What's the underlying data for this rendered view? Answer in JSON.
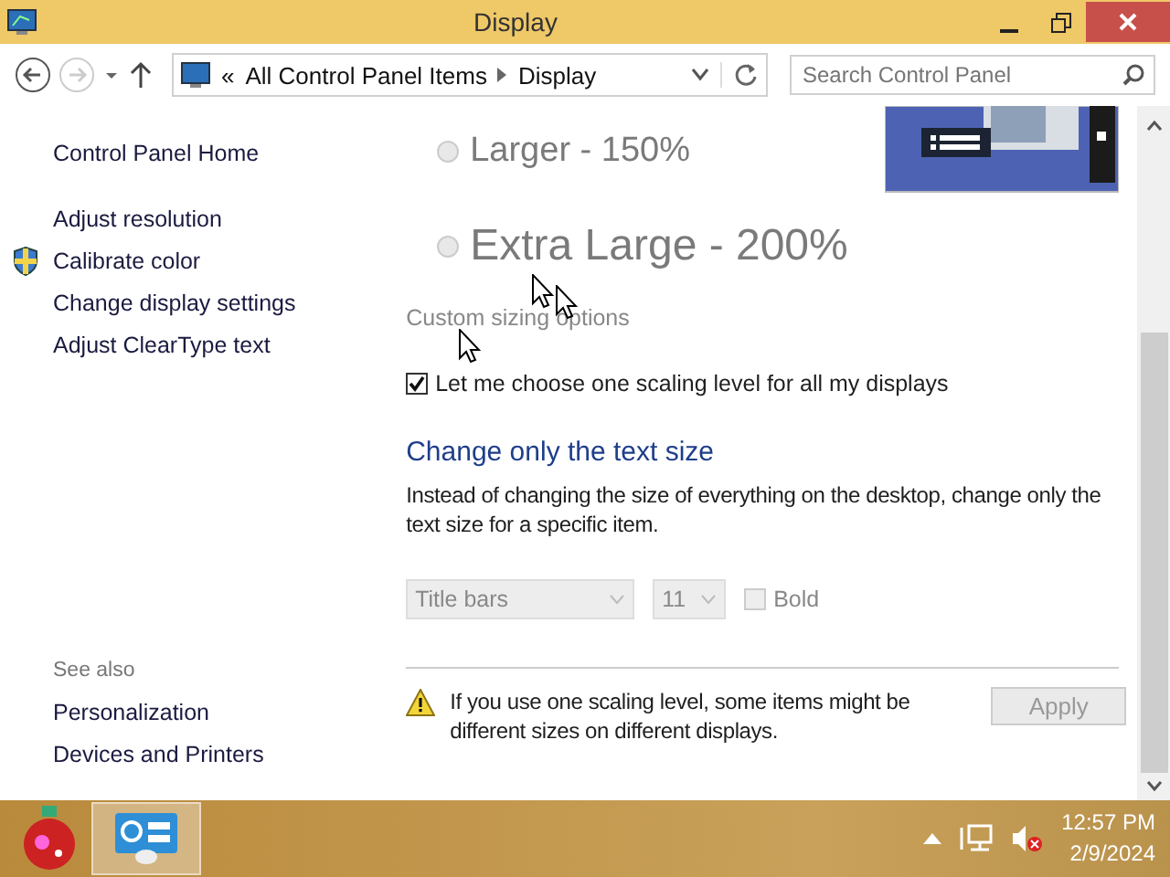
{
  "window": {
    "title": "Display"
  },
  "address_bar": {
    "prefix": "«",
    "crumbs": [
      "All Control Panel Items",
      "Display"
    ]
  },
  "search": {
    "placeholder": "Search Control Panel"
  },
  "sidebar": {
    "items": [
      {
        "label": "Control Panel Home",
        "shield": false
      },
      {
        "label": "Adjust resolution",
        "shield": false
      },
      {
        "label": "Calibrate color",
        "shield": true
      },
      {
        "label": "Change display settings",
        "shield": false
      },
      {
        "label": "Adjust ClearType text",
        "shield": false
      }
    ],
    "see_also": {
      "heading": "See also",
      "items": [
        "Personalization",
        "Devices and Printers"
      ]
    }
  },
  "scaling_options": [
    {
      "label": "Larger - 150%",
      "selected": false,
      "disabled": true,
      "kind": "large"
    },
    {
      "label": "Extra Large - 200%",
      "selected": false,
      "disabled": true,
      "kind": "xlarge"
    }
  ],
  "custom_sizing": {
    "label": "Custom sizing options",
    "disabled": true
  },
  "one_level": {
    "label": "Let me choose one scaling level for all my displays",
    "checked": true
  },
  "text_size": {
    "heading": "Change only the text size",
    "description": "Instead of changing the size of everything on the desktop, change only the text size for a specific item.",
    "item": {
      "value": "Title bars",
      "disabled": true
    },
    "size": {
      "value": "11",
      "disabled": true
    },
    "bold": {
      "label": "Bold",
      "checked": false,
      "disabled": true
    }
  },
  "warning": {
    "text": "If you use one scaling level, some items might be different sizes on different displays."
  },
  "apply_button": {
    "label": "Apply",
    "disabled": true
  },
  "taskbar": {
    "time": "12:57 PM",
    "date": "2/9/2024"
  }
}
